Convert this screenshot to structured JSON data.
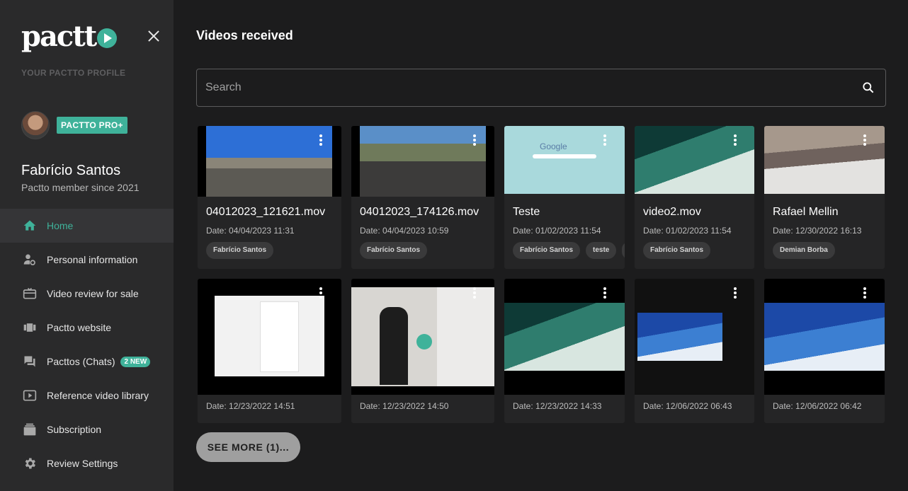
{
  "sidebar": {
    "logo_text": "pactt",
    "profile_heading": "YOUR PACTTO PROFILE",
    "pro_badge": "PACTTO PRO+",
    "user_name": "Fabrício Santos",
    "member_since": "Pactto member since 2021",
    "items": [
      {
        "label": "Home",
        "icon": "home-icon",
        "active": true
      },
      {
        "label": "Personal information",
        "icon": "person-gear-icon"
      },
      {
        "label": "Video review for sale",
        "icon": "gift-card-icon"
      },
      {
        "label": "Pactto website",
        "icon": "carousel-icon"
      },
      {
        "label": "Pacttos (Chats)",
        "icon": "chat-icon",
        "badge": "2 NEW"
      },
      {
        "label": "Reference video library",
        "icon": "video-library-icon"
      },
      {
        "label": "Subscription",
        "icon": "subscriptions-icon"
      },
      {
        "label": "Review Settings",
        "icon": "gear-icon"
      }
    ]
  },
  "main": {
    "title": "Videos received",
    "search_placeholder": "Search",
    "see_more": "SEE MORE (1)...",
    "videos": [
      {
        "title": "04012023_121621.mov",
        "date": "Date: 04/04/2023 11:31",
        "tags": [
          "Fabrício Santos"
        ]
      },
      {
        "title": "04012023_174126.mov",
        "date": "Date: 04/04/2023 10:59",
        "tags": [
          "Fabrício Santos"
        ]
      },
      {
        "title": "Teste",
        "date": "Date: 01/02/2023 11:54",
        "tags": [
          "Fabrício Santos",
          "teste",
          ""
        ]
      },
      {
        "title": "video2.mov",
        "date": "Date: 01/02/2023 11:54",
        "tags": [
          "Fabrício Santos"
        ]
      },
      {
        "title": "Rafael Mellin",
        "date": "Date: 12/30/2022 16:13",
        "tags": [
          "Demian Borba"
        ]
      },
      {
        "title": "",
        "date": "Date: 12/23/2022 14:51",
        "tags": []
      },
      {
        "title": "",
        "date": "Date: 12/23/2022 14:50",
        "tags": []
      },
      {
        "title": "",
        "date": "Date: 12/23/2022 14:33",
        "tags": []
      },
      {
        "title": "",
        "date": "Date: 12/06/2022 06:43",
        "tags": []
      },
      {
        "title": "",
        "date": "Date: 12/06/2022 06:42",
        "tags": []
      }
    ]
  },
  "colors": {
    "accent": "#3fb29a",
    "background": "#1c1c1d",
    "sidebar": "#2a2a2b",
    "card": "#252526"
  }
}
